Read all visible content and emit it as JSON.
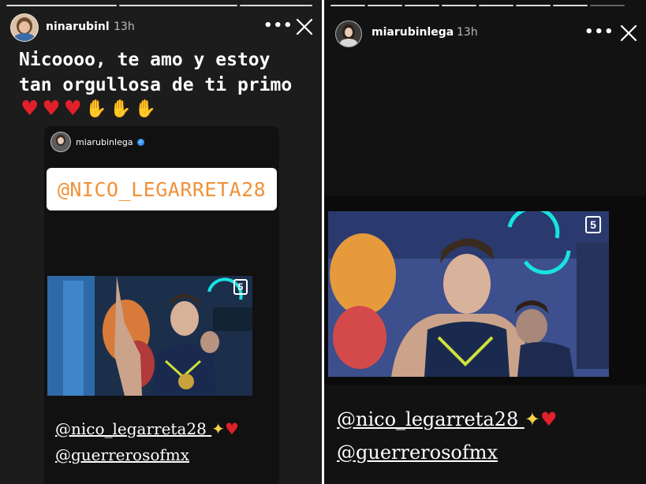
{
  "left_story": {
    "username": "ninarubinl",
    "time": "13h",
    "caption": "Nicoooo, te amo y estoy tan orgullosa de ti primo",
    "emojis": [
      "heart",
      "heart",
      "heart",
      "clap",
      "clap",
      "clap"
    ],
    "repost": {
      "username": "miarubinlega",
      "mention_sticker": "@NICO_LEGARRETA28",
      "tv_channel": "5",
      "mention_line1": "@nico_legarreta28",
      "mention_line2": "@guerrerosofmx"
    }
  },
  "right_story": {
    "username": "miarubinlega",
    "time": "13h",
    "tv_channel": "5",
    "mention_line1": "@nico_legarreta28",
    "mention_line2": "@guerrerosofmx"
  },
  "icons": {
    "more": "more-horizontal-icon",
    "close": "close-icon",
    "heart": "red-heart-emoji",
    "sparkles": "sparkles-emoji",
    "clap": "clapping-hands-emoji",
    "verified": "verified-badge-icon"
  },
  "colors": {
    "story_bg": "#1c1c1c",
    "sticker_text": "#f0923a",
    "heart": "#e0202a",
    "verified": "#3897f0"
  }
}
